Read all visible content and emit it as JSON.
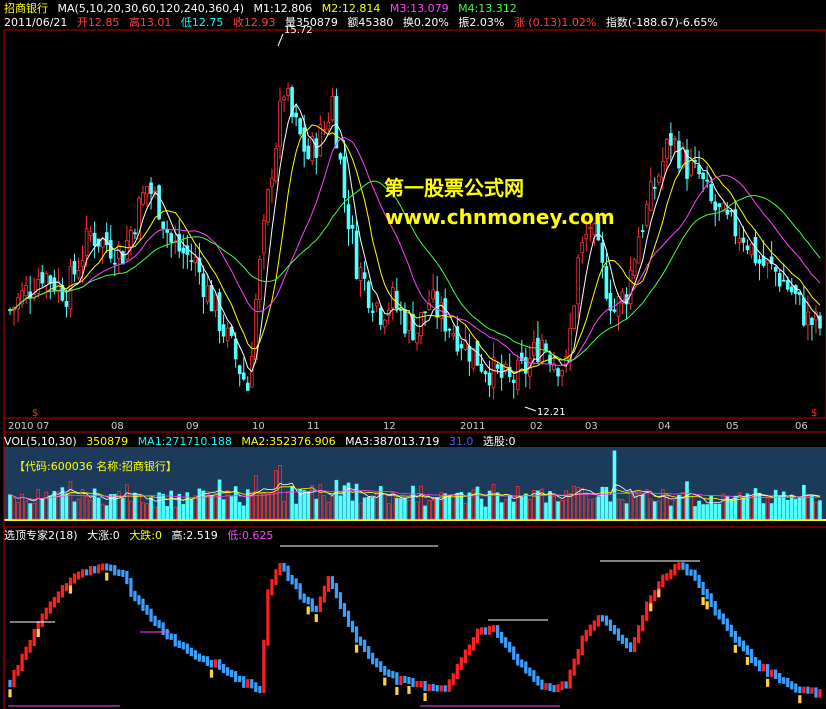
{
  "header": {
    "stock_name": "招商银行",
    "ma_params": "MA(5,10,20,30,60,120,240,360,4)",
    "m1": "M1:12.806",
    "m2": "M2:12.814",
    "m3": "M3:13.079",
    "m4": "M4:13.312",
    "date": "2011/06/21",
    "open": "开12.85",
    "high": "高13.01",
    "low": "低12.75",
    "close": "收12.93",
    "volume": "量350879",
    "amount": "额45380",
    "turnover": "换0.20%",
    "amplitude": "振2.03%",
    "change": "涨 (0.13)1.02%",
    "index": "指数(-188.67)-6.65%"
  },
  "volume_header": {
    "params": "VOL(5,10,30)",
    "vol": "350879",
    "ma1": "MA1:271710.188",
    "ma2": "MA2:352376.906",
    "ma3": "MA3:387013.719",
    "val31": "31.0",
    "pick": "选股:0"
  },
  "volume_tag": "【代码:600036 名称:招商银行】",
  "indicator_header": {
    "name": "选顶专家2(18)",
    "big_up": "大涨:0",
    "big_down": "大跌:0",
    "high": "高:2.519",
    "low": "低:0.625"
  },
  "watermark": {
    "line1": "第一股票公式网",
    "line2": "www.chnmoney.com"
  },
  "annotations": {
    "peak_high": "15.72",
    "trough_low": "12.21",
    "signal_marker": "$"
  },
  "x_ticks": [
    "2010 07",
    "08",
    "09",
    "10",
    "11",
    "12",
    "2011",
    "02",
    "03",
    "04",
    "05",
    "06"
  ],
  "colors": {
    "up": "#ff3030",
    "down": "#54ffff",
    "ma5": "#ffffff",
    "ma10": "#ffff00",
    "ma20": "#ff40ff",
    "ma30": "#40ff40",
    "frame": "#c00000"
  },
  "chart_data": {
    "type": "candlestick",
    "title": "招商银行",
    "ylim": [
      12.0,
      16.0
    ],
    "extremes": {
      "high": 15.72,
      "low": 12.21
    },
    "price_path": [
      [
        0,
        13.1
      ],
      [
        8,
        13.5
      ],
      [
        14,
        13.3
      ],
      [
        20,
        13.9
      ],
      [
        28,
        13.7
      ],
      [
        34,
        14.4
      ],
      [
        37,
        14.2
      ],
      [
        40,
        13.8
      ],
      [
        46,
        13.6
      ],
      [
        52,
        13.0
      ],
      [
        56,
        12.6
      ],
      [
        59,
        12.3
      ],
      [
        61,
        13.2
      ],
      [
        65,
        14.6
      ],
      [
        68,
        15.4
      ],
      [
        70,
        15.1
      ],
      [
        74,
        14.7
      ],
      [
        78,
        15.0
      ],
      [
        80,
        15.3
      ],
      [
        83,
        14.3
      ],
      [
        86,
        13.6
      ],
      [
        89,
        13.3
      ],
      [
        92,
        13.1
      ],
      [
        95,
        13.2
      ],
      [
        98,
        13.0
      ],
      [
        101,
        12.9
      ],
      [
        104,
        13.2
      ],
      [
        108,
        13.0
      ],
      [
        112,
        12.8
      ],
      [
        116,
        12.6
      ],
      [
        120,
        12.45
      ],
      [
        124,
        12.35
      ],
      [
        128,
        12.5
      ],
      [
        132,
        12.8
      ],
      [
        135,
        12.6
      ],
      [
        138,
        12.5
      ],
      [
        141,
        13.6
      ],
      [
        144,
        14.0
      ],
      [
        147,
        13.5
      ],
      [
        150,
        13.1
      ],
      [
        153,
        13.3
      ],
      [
        156,
        13.9
      ],
      [
        160,
        14.4
      ],
      [
        164,
        14.9
      ],
      [
        168,
        14.6
      ],
      [
        171,
        14.5
      ],
      [
        174,
        14.2
      ],
      [
        178,
        14.0
      ],
      [
        182,
        13.9
      ],
      [
        186,
        13.6
      ],
      [
        190,
        13.5
      ],
      [
        194,
        13.3
      ],
      [
        198,
        13.0
      ],
      [
        201,
        12.93
      ]
    ],
    "volume_ylim": [
      0,
      1200000
    ]
  },
  "indicator_data": {
    "ylim": [
      0,
      3
    ],
    "path": [
      [
        0,
        0.4
      ],
      [
        4,
        1.0
      ],
      [
        8,
        1.6
      ],
      [
        12,
        2.0
      ],
      [
        16,
        2.3
      ],
      [
        22,
        2.5
      ],
      [
        28,
        2.4
      ],
      [
        30,
        2.0
      ],
      [
        36,
        1.5
      ],
      [
        40,
        1.2
      ],
      [
        46,
        0.9
      ],
      [
        52,
        0.7
      ],
      [
        58,
        0.4
      ],
      [
        62,
        0.3
      ],
      [
        64,
        2.0
      ],
      [
        67,
        2.55
      ],
      [
        72,
        2.0
      ],
      [
        76,
        1.7
      ],
      [
        79,
        2.3
      ],
      [
        82,
        1.8
      ],
      [
        86,
        1.2
      ],
      [
        90,
        0.8
      ],
      [
        96,
        0.45
      ],
      [
        102,
        0.35
      ],
      [
        108,
        0.3
      ],
      [
        112,
        0.8
      ],
      [
        116,
        1.3
      ],
      [
        120,
        1.4
      ],
      [
        124,
        1.0
      ],
      [
        128,
        0.6
      ],
      [
        132,
        0.35
      ],
      [
        135,
        0.3
      ],
      [
        138,
        0.35
      ],
      [
        142,
        1.2
      ],
      [
        146,
        1.6
      ],
      [
        150,
        1.3
      ],
      [
        154,
        1.0
      ],
      [
        158,
        1.8
      ],
      [
        162,
        2.3
      ],
      [
        166,
        2.55
      ],
      [
        170,
        2.3
      ],
      [
        174,
        1.8
      ],
      [
        178,
        1.4
      ],
      [
        182,
        1.0
      ],
      [
        186,
        0.7
      ],
      [
        190,
        0.5
      ],
      [
        194,
        0.3
      ],
      [
        198,
        0.25
      ],
      [
        201,
        0.2
      ]
    ]
  }
}
